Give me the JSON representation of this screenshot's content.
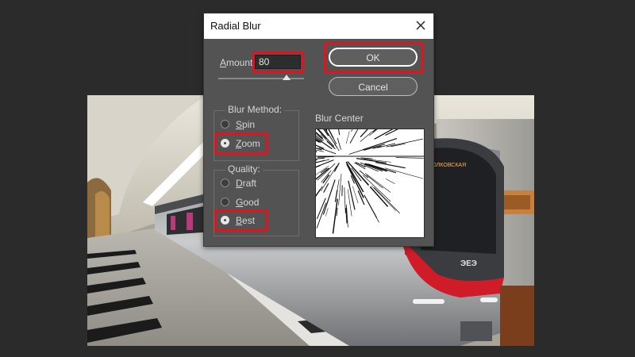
{
  "dialog": {
    "title": "Radial Blur",
    "close_icon": "close-icon"
  },
  "amount": {
    "label_first": "A",
    "label_rest": "mount",
    "value": "80",
    "slider_fraction": 0.8
  },
  "buttons": {
    "ok": "OK",
    "cancel": "Cancel"
  },
  "blur_method": {
    "legend": "Blur Method:",
    "options": [
      {
        "first": "S",
        "rest": "pin",
        "selected": false
      },
      {
        "first": "Z",
        "rest": "oom",
        "selected": true
      }
    ]
  },
  "quality": {
    "legend": "Quality:",
    "options": [
      {
        "first": "D",
        "rest": "raft",
        "selected": false
      },
      {
        "first": "G",
        "rest": "ood",
        "selected": false
      },
      {
        "first": "B",
        "rest": "est",
        "selected": true
      }
    ]
  },
  "blur_center": {
    "label": "Blur Center"
  },
  "background_image": {
    "train_sign": "ВОЛКОВСКАЯ",
    "train_logo": "ЭЕЭ"
  },
  "highlight_color": "#e0141e"
}
